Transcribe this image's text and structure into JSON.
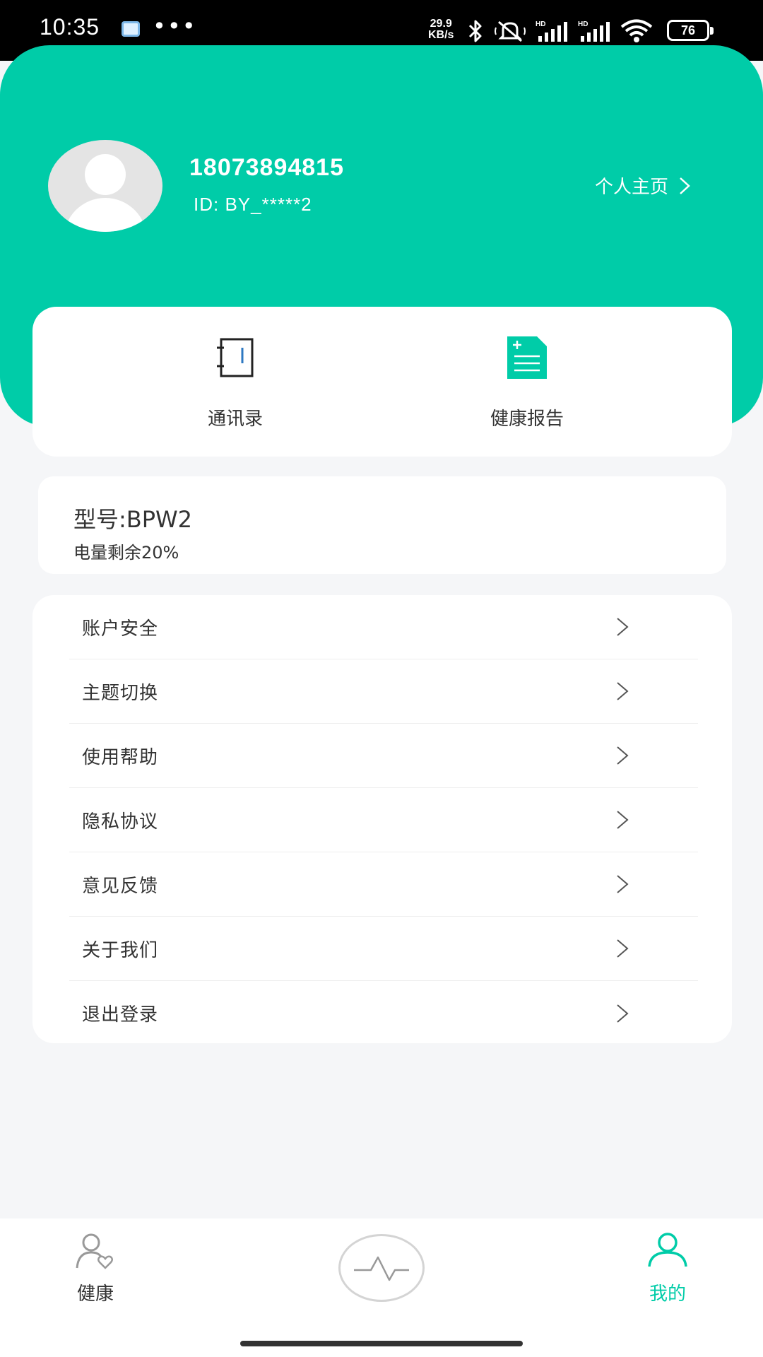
{
  "status_bar": {
    "time": "10:35",
    "more": "•••",
    "net_speed_value": "29.9",
    "net_speed_unit": "KB/s",
    "battery": "76",
    "icons": [
      "gallery-icon",
      "bluetooth-icon",
      "mute-icon",
      "hd-signal-icon",
      "hd-signal-icon",
      "wifi-icon"
    ]
  },
  "profile": {
    "phone": "18073894815",
    "id": "ID: BY_*****2",
    "homepage_label": "个人主页"
  },
  "shortcuts": [
    {
      "label": "通讯录",
      "icon": "contacts-book-icon"
    },
    {
      "label": "健康报告",
      "icon": "health-report-icon"
    }
  ],
  "device": {
    "model": "型号:BPW2",
    "battery": "电量剩余20%"
  },
  "menu": [
    {
      "label": "账户安全"
    },
    {
      "label": "主题切换"
    },
    {
      "label": "使用帮助"
    },
    {
      "label": "隐私协议"
    },
    {
      "label": "意见反馈"
    },
    {
      "label": "关于我们"
    },
    {
      "label": "退出登录"
    }
  ],
  "bottom_nav": {
    "health_label": "健康",
    "mine_label": "我的",
    "active": "mine"
  },
  "colors": {
    "brand": "#00cca8",
    "background": "#f5f6f8",
    "text": "#333333"
  }
}
